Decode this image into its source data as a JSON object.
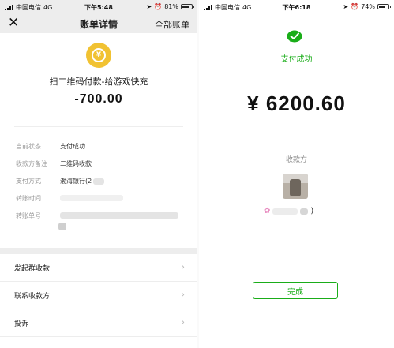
{
  "left_screen": {
    "status_bar": {
      "carrier": "中国电信",
      "network": "4G",
      "time": "下午5:48",
      "battery": "81%",
      "battery_level": 0.81
    },
    "navbar": {
      "close_icon": "close-icon",
      "title": "账单详情",
      "right_link": "全部账单"
    },
    "merchant_icon": "coin-icon",
    "merchant": "扫二维码付款-给游戏快充",
    "amount": "-700.00",
    "details": [
      {
        "label": "当前状态",
        "value": "支付成功"
      },
      {
        "label": "收款方备注",
        "value": "二维码收款"
      },
      {
        "label": "支付方式",
        "value": "渤海银行(2"
      },
      {
        "label": "转账时间",
        "value": ""
      },
      {
        "label": "转账单号",
        "value": ""
      }
    ],
    "menu": [
      {
        "label": "发起群收款"
      },
      {
        "label": "联系收款方"
      },
      {
        "label": "投诉"
      }
    ],
    "accent_color": "#f1c232"
  },
  "right_screen": {
    "status_bar": {
      "carrier": "中国电信",
      "network": "4G",
      "time": "下午6:18",
      "battery": "74%",
      "battery_level": 0.74
    },
    "status_icon": "success-chat-icon",
    "status_text": "支付成功",
    "amount": "¥ 6200.60",
    "payee_label": "收款方",
    "payee_name_suffix": ")",
    "done_button": "完成",
    "accent_color": "#1aad19"
  }
}
